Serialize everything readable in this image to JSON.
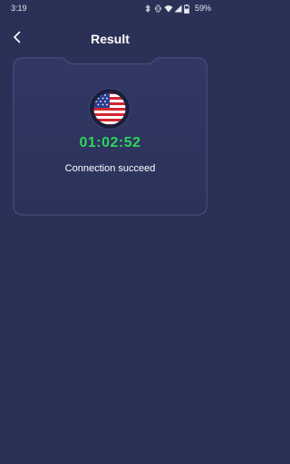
{
  "status_bar": {
    "time": "3:19",
    "battery": "59%",
    "icons": [
      "bluetooth-icon",
      "vibrate-icon",
      "wifi-icon",
      "signal-icon",
      "battery-icon"
    ]
  },
  "header": {
    "title": "Result",
    "back_icon": "chevron-left-icon"
  },
  "result_card": {
    "flag": "us-flag-icon",
    "duration": "01:02:52",
    "message": "Connection succeed"
  },
  "colors": {
    "background": "#2b3156",
    "card": "#2f3560",
    "timer": "#2fd45a"
  }
}
